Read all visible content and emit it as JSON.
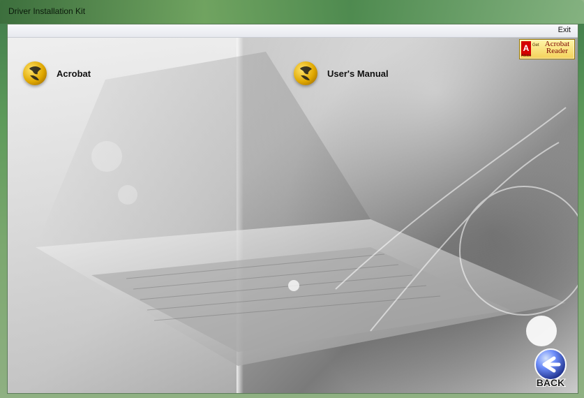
{
  "window": {
    "title": "Driver Installation Kit"
  },
  "menu": {
    "exit_label": "Exit"
  },
  "items": [
    {
      "label": "Acrobat",
      "icon": "globe-icon"
    },
    {
      "label": "User's Manual",
      "icon": "globe-icon"
    }
  ],
  "adobe_badge": {
    "small": "Get",
    "brand": "Adobe",
    "text": "Acrobat Reader"
  },
  "back_button": {
    "label": "BACK"
  },
  "colors": {
    "globe": "#e0a800",
    "badge": "#f4d15a",
    "back_blue": "#2e5bd6"
  }
}
